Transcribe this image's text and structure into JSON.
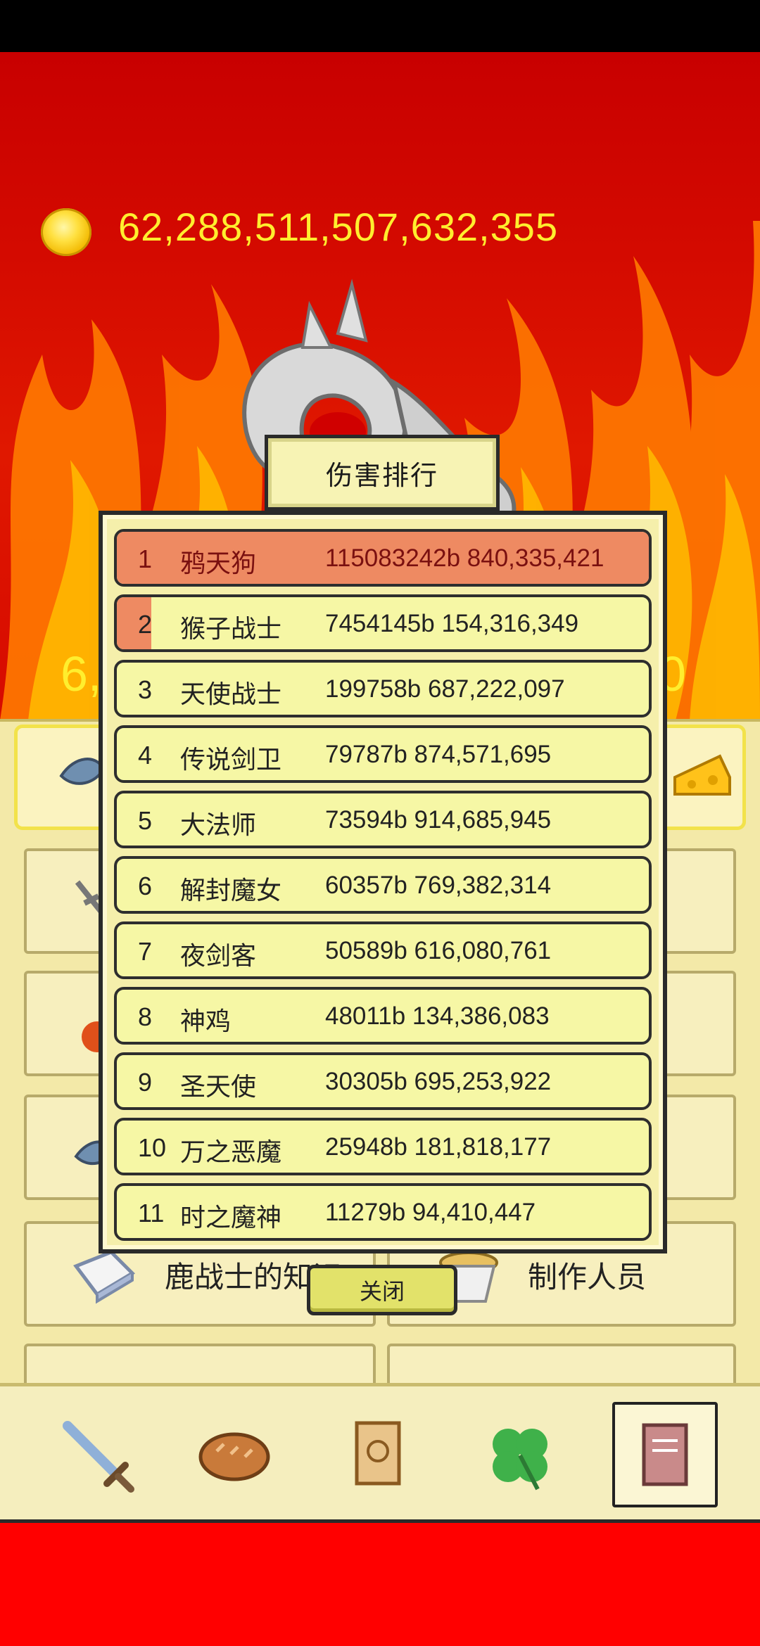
{
  "coins": {
    "amount": "62,288,511,507,632,355"
  },
  "stage": {
    "number_left": "6,",
    "number_right": "0"
  },
  "menu": {
    "knowledge_label": "鹿战士的知识",
    "credits_label": "制作人员"
  },
  "ranking": {
    "title": "伤害排行",
    "rows": [
      {
        "rank": "1",
        "name": "鸦天狗",
        "damage": "115083242b 840,335,421",
        "fill": 1.0
      },
      {
        "rank": "2",
        "name": "猴子战士",
        "damage": "7454145b 154,316,349",
        "fill": 0.065
      },
      {
        "rank": "3",
        "name": "天使战士",
        "damage": "199758b 687,222,097",
        "fill": 0.0
      },
      {
        "rank": "4",
        "name": "传说剑卫",
        "damage": "79787b 874,571,695",
        "fill": 0.0
      },
      {
        "rank": "5",
        "name": "大法师",
        "damage": "73594b 914,685,945",
        "fill": 0.0
      },
      {
        "rank": "6",
        "name": "解封魔女",
        "damage": "60357b 769,382,314",
        "fill": 0.0
      },
      {
        "rank": "7",
        "name": "夜剑客",
        "damage": "50589b 616,080,761",
        "fill": 0.0
      },
      {
        "rank": "8",
        "name": "神鸡",
        "damage": "48011b 134,386,083",
        "fill": 0.0
      },
      {
        "rank": "9",
        "name": "圣天使",
        "damage": "30305b 695,253,922",
        "fill": 0.0
      },
      {
        "rank": "10",
        "name": "万之恶魔",
        "damage": "25948b 181,818,177",
        "fill": 0.0
      },
      {
        "rank": "11",
        "name": "时之魔神",
        "damage": "11279b 94,410,447",
        "fill": 0.0
      }
    ],
    "close_label": "关闭"
  },
  "nav": {
    "items": [
      {
        "icon": "sword-icon"
      },
      {
        "icon": "bread-icon"
      },
      {
        "icon": "scroll-icon"
      },
      {
        "icon": "clover-icon"
      },
      {
        "icon": "book-icon",
        "selected": true
      }
    ]
  },
  "colors": {
    "fire_red": "#c80000",
    "gold_text": "#ffee2e",
    "row_bg": "#f6f7a5",
    "row_fill": "#ee8a62"
  }
}
